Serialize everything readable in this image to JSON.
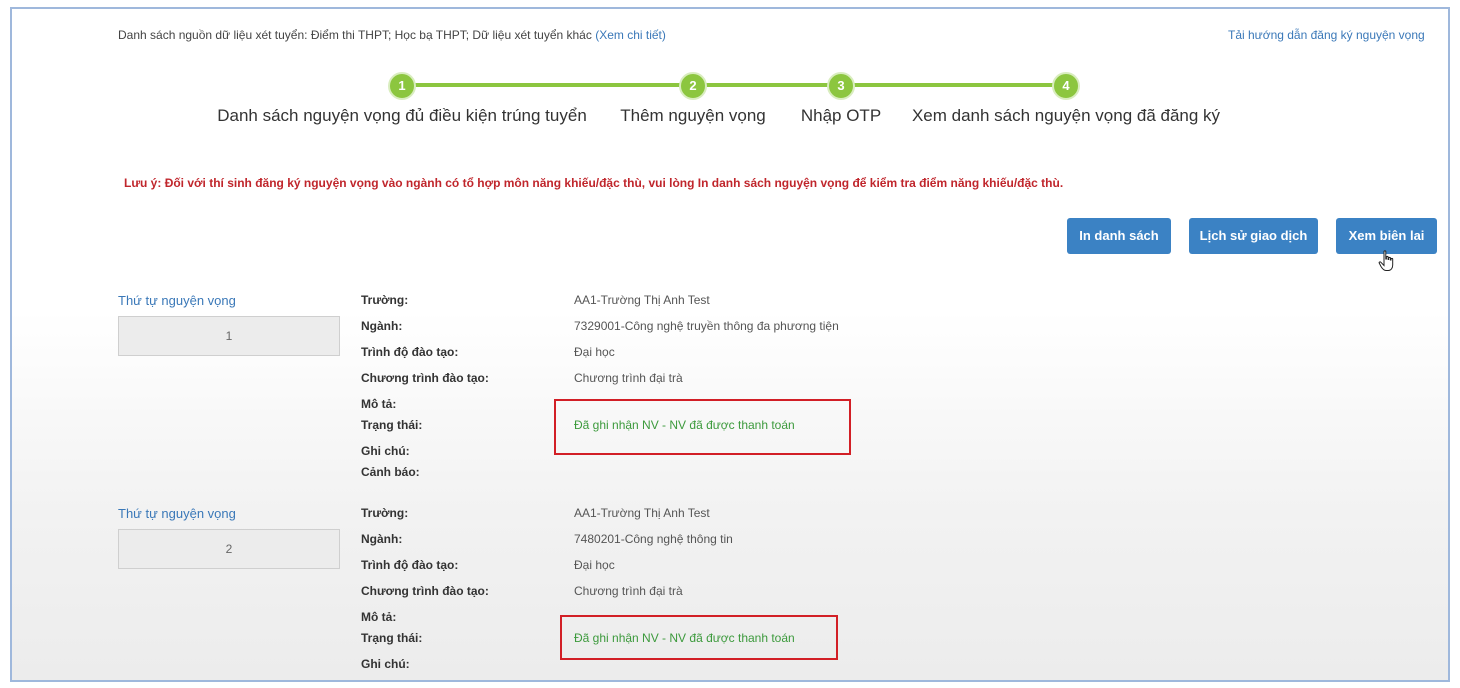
{
  "header": {
    "sources_text": "Danh sách nguồn dữ liệu xét tuyển: Điểm thi THPT; Học bạ THPT; Dữ liệu xét tuyển khác",
    "sources_link": "(Xem chi tiết)",
    "guide_link": "Tải hướng dẫn đăng ký nguyện vọng"
  },
  "steps": [
    {
      "num": "1",
      "label": "Danh sách nguyện vọng đủ điều kiện trúng tuyển"
    },
    {
      "num": "2",
      "label": "Thêm nguyện vọng"
    },
    {
      "num": "3",
      "label": "Nhập OTP"
    },
    {
      "num": "4",
      "label": "Xem danh sách nguyện vọng đã đăng ký"
    }
  ],
  "note": "Lưu ý: Đối với thí sinh đăng ký nguyện vọng vào ngành có tổ hợp môn năng khiếu/đặc thù, vui lòng In danh sách nguyện vọng để kiểm tra điểm năng khiếu/đặc thù.",
  "buttons": {
    "print": "In danh sách",
    "history": "Lịch sử giao dịch",
    "receipt": "Xem biên lai"
  },
  "labels": {
    "order_title": "Thứ tự nguyện vọng",
    "school": "Trường:",
    "major": "Ngành:",
    "level": "Trình độ đào tạo:",
    "program": "Chương trình đào tạo:",
    "description": "Mô tả:",
    "status": "Trạng thái:",
    "remark": "Ghi chú:",
    "warning": "Cảnh báo:"
  },
  "wishes": [
    {
      "order": "1",
      "school": "AA1-Trường Thị Anh Test",
      "major": "7329001-Công nghệ truyền thông đa phương tiện",
      "level": "Đại học",
      "program": "Chương trình đại trà",
      "status": "Đã ghi nhận NV - NV đã được thanh toán"
    },
    {
      "order": "2",
      "school": "AA1-Trường Thị Anh Test",
      "major": "7480201-Công nghệ thông tin",
      "level": "Đại học",
      "program": "Chương trình đại trà",
      "status": "Đã ghi nhận NV - NV đã được thanh toán"
    }
  ],
  "colors": {
    "accent_green": "#8cc63f",
    "button_blue": "#3b82c4",
    "warning_red": "#c0262c",
    "highlight_box": "#d21f26"
  }
}
